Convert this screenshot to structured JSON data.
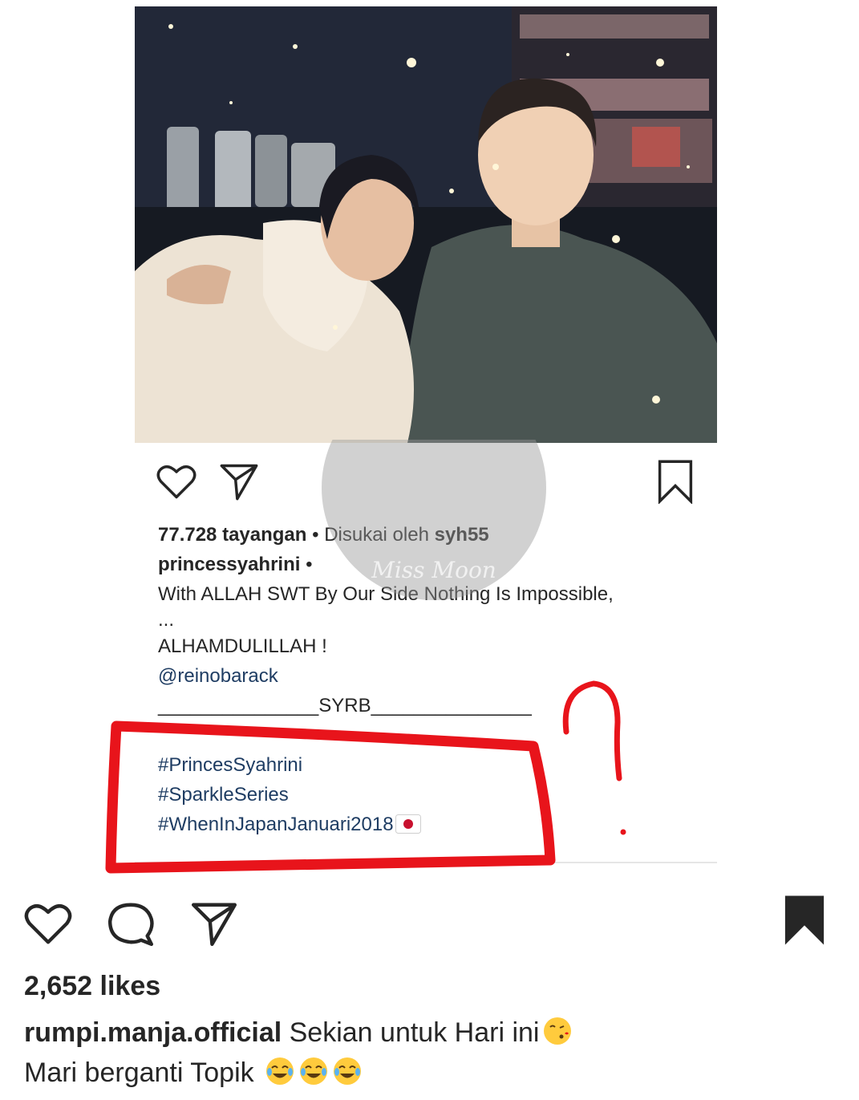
{
  "inner_post": {
    "views": "77.728 tayangan",
    "separator": " • ",
    "liked_by_prefix": "Disukai oleh ",
    "liked_by_user": "syh55",
    "username": "princessyahrini",
    "username_suffix": " •",
    "caption_lines": [
      "With ALLAH SWT By Our Side Nothing Is Impossible,",
      "...",
      "ALHAMDULILLAH !",
      "@reinobarack",
      "_______________SYRB_______________",
      "",
      "#PrincesSyahrini",
      "#SparkleSeries",
      "#WhenInJapanJanuari2018"
    ],
    "watermark_text": "Miss Moon"
  },
  "outer_post": {
    "likes": "2,652 likes",
    "username": "rumpi.manja.official",
    "caption_line1": " Sekian untuk Hari ini",
    "caption_line2": "Mari berganti Topik"
  },
  "colors": {
    "annotation_red": "#e8141b",
    "text": "#262626",
    "link": "#1f3d63"
  },
  "icons": [
    "heart-icon",
    "share-icon",
    "bookmark-icon",
    "comment-icon",
    "kiss-emoji",
    "tears-of-joy-emoji",
    "japan-flag-emoji"
  ]
}
